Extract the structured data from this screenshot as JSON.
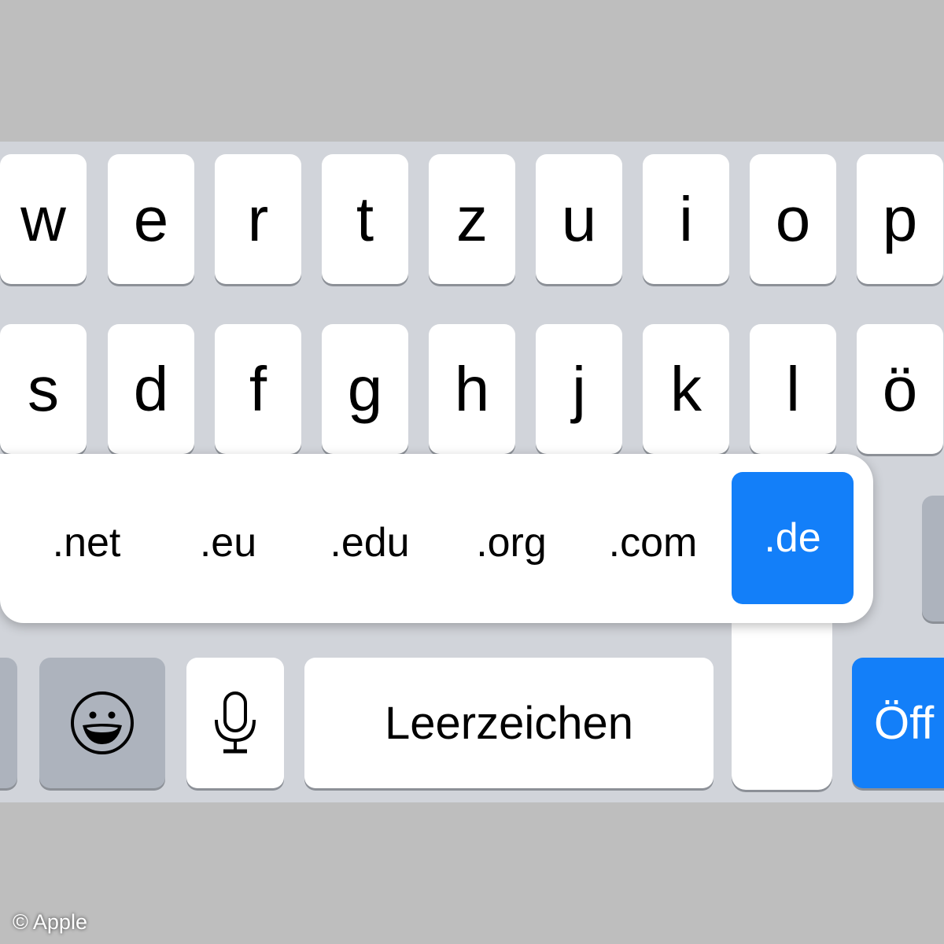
{
  "keyboard": {
    "row1": [
      "w",
      "e",
      "r",
      "t",
      "z",
      "u",
      "i",
      "o",
      "p"
    ],
    "row2": [
      "s",
      "d",
      "f",
      "g",
      "h",
      "j",
      "k",
      "l",
      "ö"
    ],
    "space_label": "Leerzeichen",
    "go_label": "Öff",
    "emoji_icon": "emoji-icon",
    "mic_icon": "microphone-icon"
  },
  "popup": {
    "options": [
      ".net",
      ".eu",
      ".edu",
      ".org",
      ".com",
      ".de"
    ],
    "selected": ".de",
    "accent": "#137ff9"
  },
  "copyright": "© Apple"
}
